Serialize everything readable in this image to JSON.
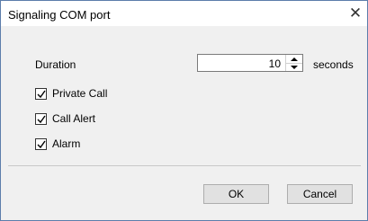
{
  "window": {
    "title": "Signaling COM port",
    "close_glyph": "✕"
  },
  "duration": {
    "label": "Duration",
    "value": "10",
    "unit": "seconds"
  },
  "options": [
    {
      "label": "Private Call",
      "checked": true
    },
    {
      "label": "Call Alert",
      "checked": true
    },
    {
      "label": "Alarm",
      "checked": true
    }
  ],
  "buttons": {
    "ok": "OK",
    "cancel": "Cancel"
  },
  "colors": {
    "border": "#5c7dab",
    "body": "#f0f0f0",
    "button": "#e1e1e1"
  }
}
